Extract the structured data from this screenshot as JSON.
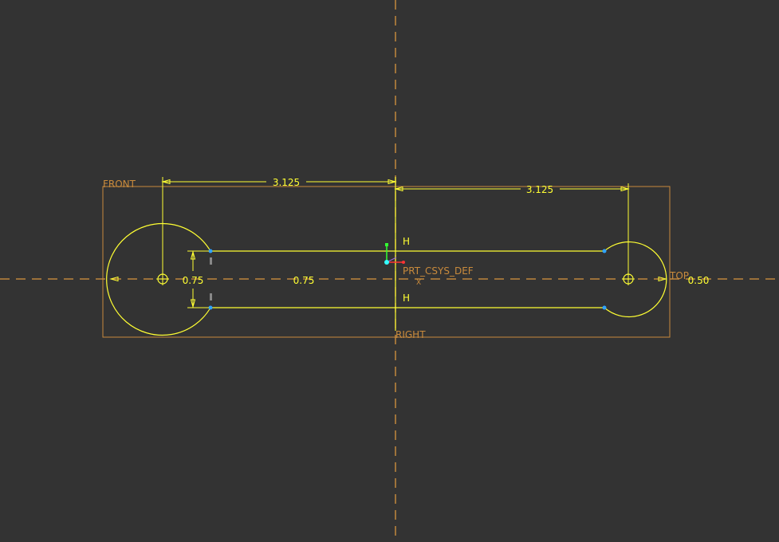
{
  "colors": {
    "background": "#333333",
    "sketch": "#ffff33",
    "datum": "#c88a3c",
    "endpoint": "#2fa3ff",
    "csys_x": "#ff3333",
    "csys_y": "#33ff33",
    "csys_origin": "#33ffff"
  },
  "datum_planes": {
    "front": "FRONT",
    "top": "TOP",
    "right": "RIGHT"
  },
  "csys_label": "PRT_CSYS_DEF",
  "csys_axis_label": "X",
  "dimensions": {
    "left_span": "3.125",
    "right_span": "3.125",
    "left_height": "0.75",
    "center_height": "0.75",
    "right_diameter": "0.50"
  },
  "constraints": {
    "upper": "H",
    "lower": "H"
  }
}
